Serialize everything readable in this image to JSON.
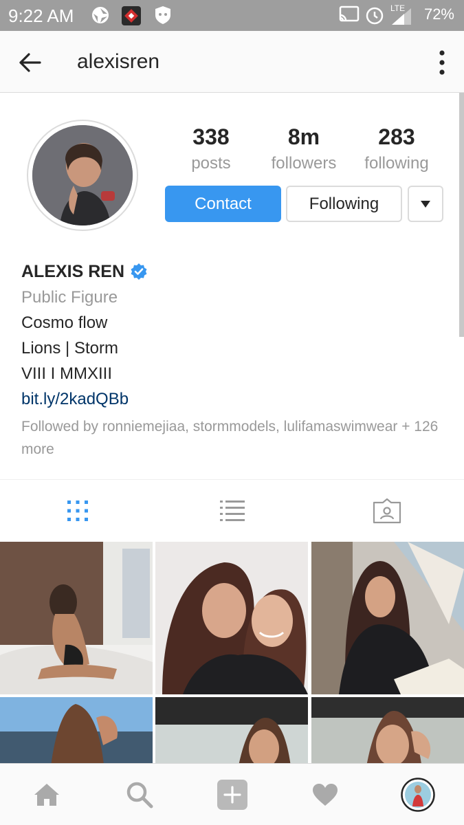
{
  "status_bar": {
    "time": "9:22 AM",
    "network": "LTE",
    "battery": "72%"
  },
  "header": {
    "username": "alexisren"
  },
  "profile": {
    "stats": [
      {
        "value": "338",
        "label": "posts"
      },
      {
        "value": "8m",
        "label": "followers"
      },
      {
        "value": "283",
        "label": "following"
      }
    ],
    "contact_label": "Contact",
    "following_label": "Following",
    "name": "ALEXIS REN",
    "category": "Public Figure",
    "bio_lines": [
      "Cosmo flow",
      "Lions | Storm",
      "VIII I MMXIII"
    ],
    "link": "bit.ly/2kadQBb",
    "followed_by": "Followed by ronniemejiaa, stormmodels, lulifamaswimwear + 126 more"
  },
  "tabs": [
    {
      "icon": "grid-view-icon",
      "active": true
    },
    {
      "icon": "list-view-icon",
      "active": false
    },
    {
      "icon": "tagged-photos-icon",
      "active": false
    }
  ],
  "bottom_nav": [
    {
      "icon": "home-icon"
    },
    {
      "icon": "search-icon"
    },
    {
      "icon": "add-post-icon"
    },
    {
      "icon": "heart-icon"
    },
    {
      "icon": "profile-avatar-icon"
    }
  ],
  "colors": {
    "accent_blue": "#3897f0",
    "link_blue": "#003569",
    "muted_gray": "#999999",
    "status_bar": "#9e9e9e",
    "verified_blue": "#3897f0"
  }
}
